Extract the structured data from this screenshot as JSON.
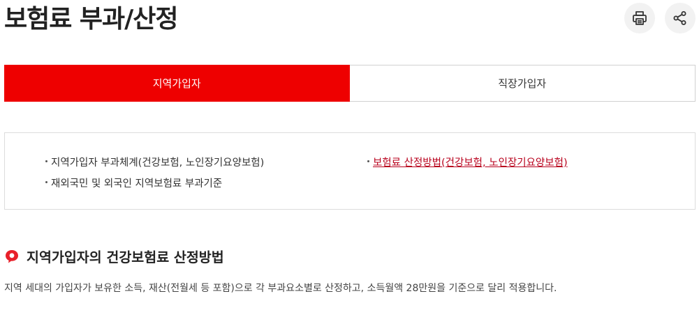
{
  "header": {
    "title": "보험료 부과/산정",
    "print_icon": "print-icon",
    "share_icon": "share-icon"
  },
  "tabs": [
    {
      "label": "지역가입자",
      "active": true
    },
    {
      "label": "직장가입자",
      "active": false
    }
  ],
  "links": [
    {
      "label": "지역가입자 부과체계(건강보험, 노인장기요양보험)",
      "active": false
    },
    {
      "label": "재외국민 및 외국인 지역보험료 부과기준",
      "active": false
    },
    {
      "label": "보험료 산정방법(건강보험, 노인장기요양보험)",
      "active": true
    }
  ],
  "section": {
    "title": "지역가입자의 건강보험료 산정방법",
    "icon": "speech-bubble-icon",
    "description": "지역 세대의 가입자가 보유한 소득, 재산(전월세 등 포함)으로 각 부과요소별로 산정하고, 소득월액 28만원을 기준으로 달리 적용합니다."
  },
  "colors": {
    "accent": "#ee0000",
    "active_link": "#b8001c"
  }
}
